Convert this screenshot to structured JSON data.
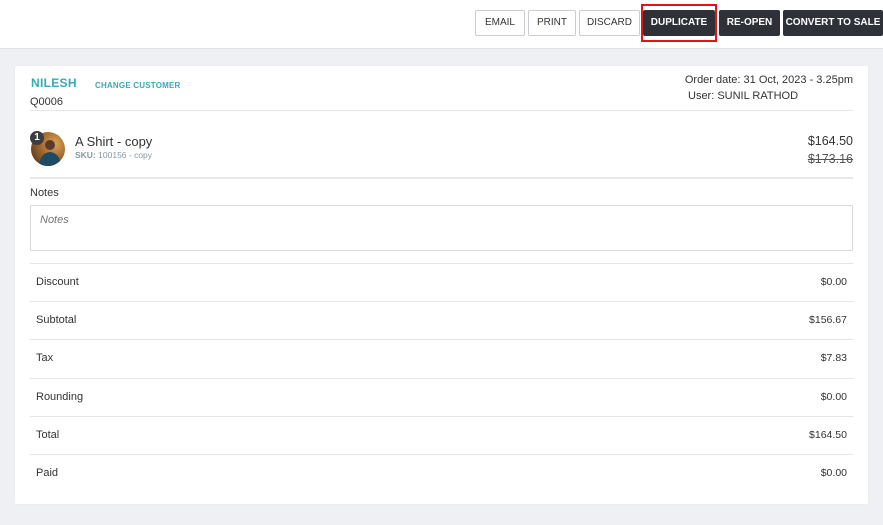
{
  "toolbar": {
    "email_label": "EMAIL",
    "print_label": "PRINT",
    "discard_label": "DISCARD",
    "duplicate_label": "DUPLICATE",
    "reopen_label": "RE-OPEN",
    "convert_label": "CONVERT TO SALE"
  },
  "order": {
    "customer_name": "NILESH",
    "change_customer_label": "CHANGE CUSTOMER",
    "quote_number": "Q0006",
    "order_date": "Order date: 31 Oct, 2023 - 3.25pm",
    "user": "User: SUNIL RATHOD"
  },
  "line_items": [
    {
      "quantity": "1",
      "name": "A Shirt - copy",
      "sku_label": "SKU:",
      "sku_value": "100156 - copy",
      "price": "$164.50",
      "original_price": "$173.16"
    }
  ],
  "notes": {
    "label": "Notes",
    "placeholder": "Notes"
  },
  "summary": [
    {
      "label": "Discount",
      "value": "$0.00"
    },
    {
      "label": "Subtotal",
      "value": "$156.67"
    },
    {
      "label": "Tax",
      "value": "$7.83"
    },
    {
      "label": "Rounding",
      "value": "$0.00"
    },
    {
      "label": "Total",
      "value": "$164.50"
    },
    {
      "label": "Paid",
      "value": "$0.00"
    }
  ],
  "colors": {
    "accent": "#3aa8b8",
    "dark_button": "#2e3238",
    "highlight_box": "#e0141b"
  }
}
